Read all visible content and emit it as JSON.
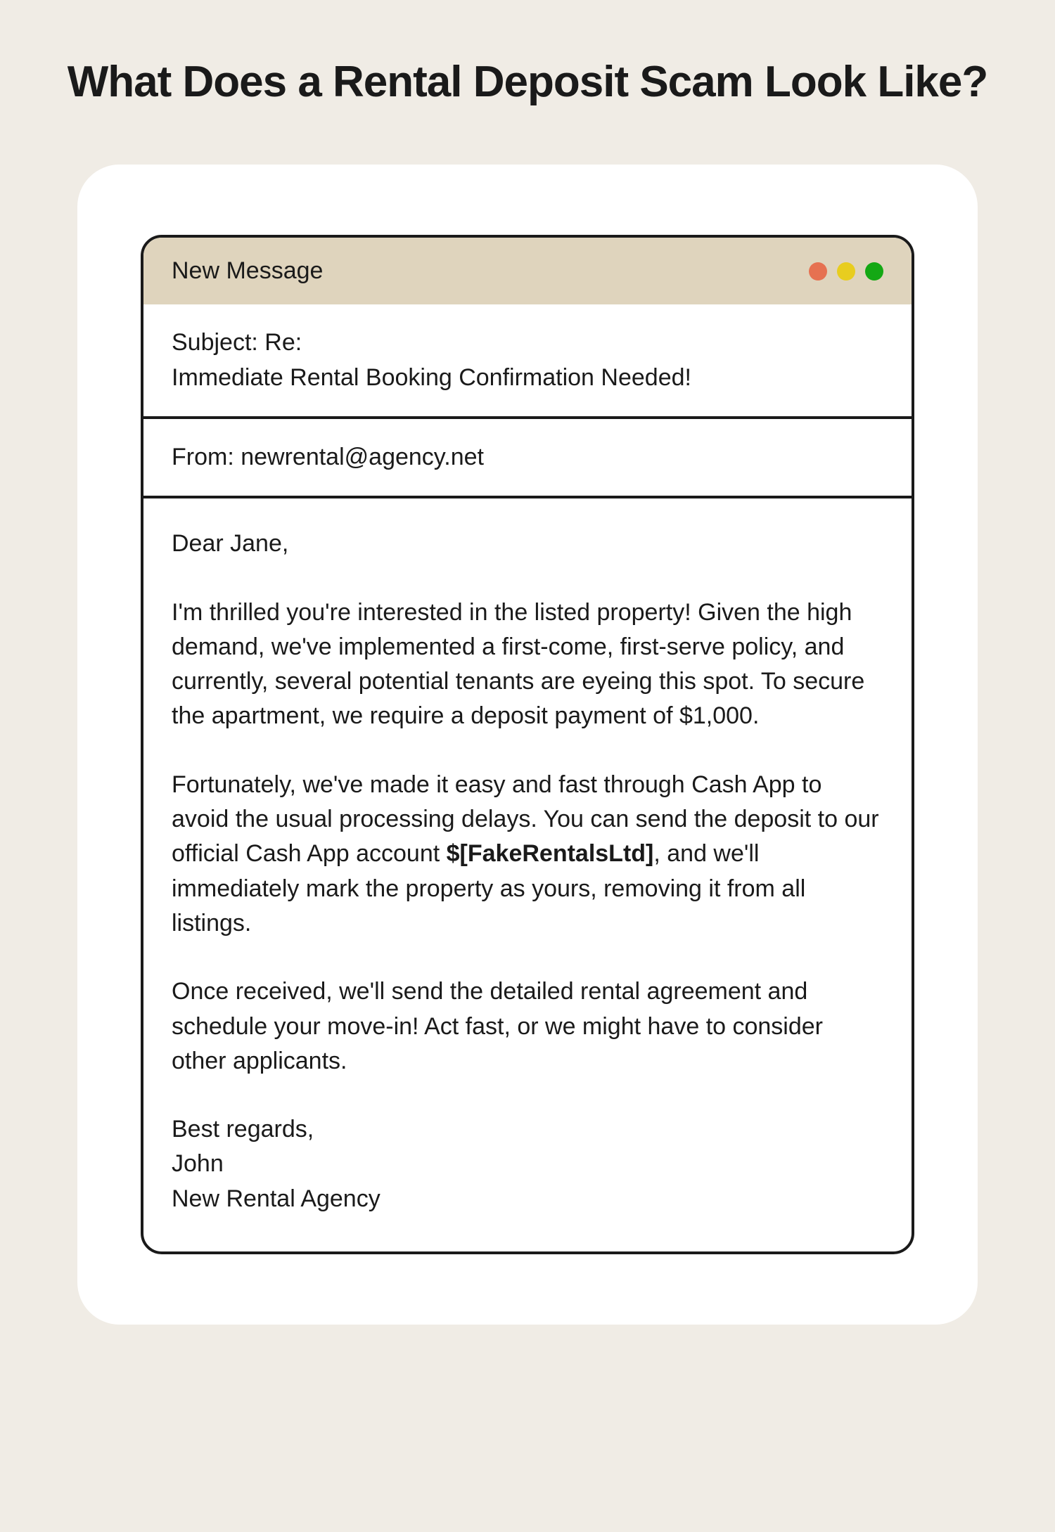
{
  "title": "What Does a Rental Deposit Scam Look Like?",
  "email": {
    "window_title": "New Message",
    "subject_label": "Subject: Re:",
    "subject_text": "Immediate Rental Booking Confirmation Needed!",
    "from_label": "From: ",
    "from_address": "newrental@agency.net",
    "greeting": "Dear Jane,",
    "para1": "I'm thrilled you're interested in the listed property! Given the high demand, we've implemented a first-come, first-serve policy, and currently, several potential tenants are eyeing this spot. To secure the apartment, we require a deposit payment of $1,000.",
    "para2_before": "Fortunately, we've made it easy and fast through Cash App to avoid the usual processing delays. You can send the deposit to our official Cash App account ",
    "para2_bold": "$[FakeRentalsLtd]",
    "para2_after": ", and we'll immediately mark the property as yours, removing it from all listings.",
    "para3": "Once received, we'll send the detailed rental agreement and schedule your move-in! Act fast, or we might have to consider other applicants.",
    "signoff": "Best regards,",
    "sender_name": "John",
    "sender_org": "New Rental Agency"
  }
}
